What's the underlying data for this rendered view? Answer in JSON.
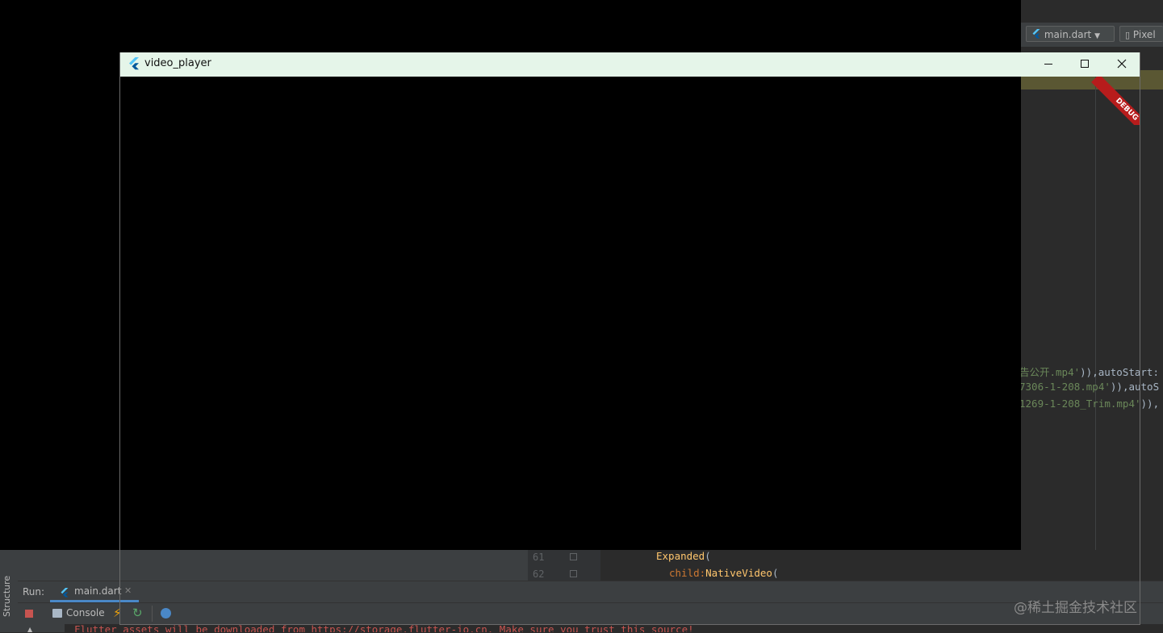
{
  "ide": {
    "run_config": "main.dart",
    "device": "Pixel",
    "code_fragments": [
      {
        "text": "告公开.mp4')),autoStart:",
        "parts": [
          "告公开.mp4'",
          ")),autoStart:"
        ]
      },
      {
        "text": "7306-1-208.mp4')),autoS",
        "parts": [
          "7306-1-208.mp4'",
          ")),autoS"
        ]
      },
      {
        "text": "1269-1-208_Trim.mp4')),",
        "parts": [
          "1269-1-208_Trim.mp4'",
          ")),"
        ]
      }
    ],
    "lines": [
      {
        "number": "61",
        "code_cls": "Expanded",
        "code_rest": "("
      },
      {
        "number": "62",
        "code_kw": "child:",
        "code_cls": "NativeVideo",
        "code_rest": "("
      }
    ],
    "run_label": "Run:",
    "run_tab": "main.dart",
    "console_label": "Console",
    "structure_label": "Structure",
    "console_text": "Flutter assets will be downloaded from https://storage.flutter-io.cn. Make sure you trust this source!"
  },
  "app_window": {
    "title": "video_player",
    "debug_banner": "DEBUG",
    "minimize_icon": "minimize-icon",
    "maximize_icon": "maximize-icon",
    "close_icon": "close-icon"
  },
  "watermark": "@稀土掘金技术社区",
  "colors": {
    "titlebar_bg": "#e5f5e9",
    "debug_banner": "#b71c1c",
    "editor_bg": "#2b2b2b"
  }
}
